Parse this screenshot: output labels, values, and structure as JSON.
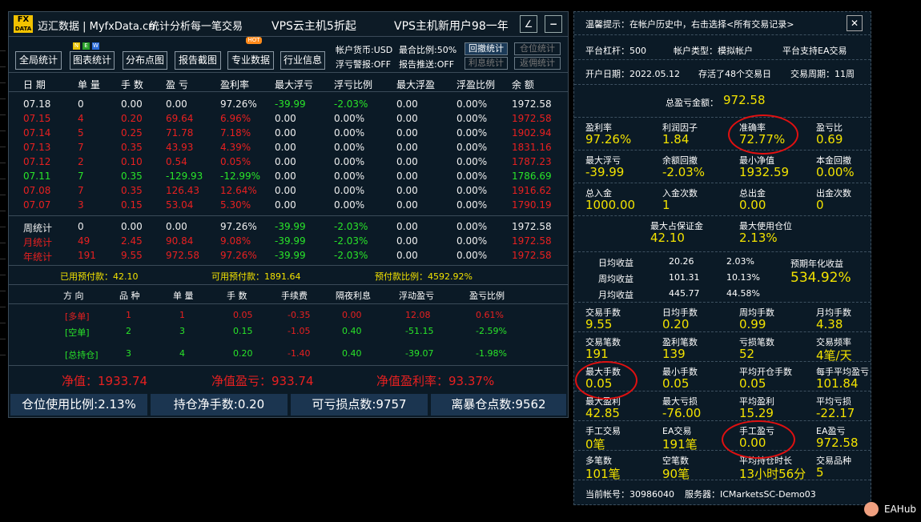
{
  "side_strip": [
    "",
    "",
    "",
    "",
    "",
    "",
    "",
    "",
    "",
    "",
    "",
    "",
    "",
    "",
    "",
    "",
    "",
    "",
    "",
    ""
  ],
  "titlebar": {
    "logo_top": "FX",
    "logo_bottom": "DATA",
    "site": "迈汇数据 | MyfxData.cn",
    "slogan": "统计分析每一笔交易",
    "ad1": "VPS云主机5折起",
    "ad2": "VPS主机新用户98一年",
    "edit_icon": "∠",
    "min_icon": "−"
  },
  "toolbar": {
    "buttons": [
      "全局统计",
      "图表统计",
      "分布点图",
      "报告截图",
      "专业数据",
      "行业信息"
    ],
    "new_badge": [
      "N",
      "E",
      "W"
    ],
    "hot_badge": "HOT",
    "info": {
      "currency": "帐户货币:USD",
      "max_ratio": "最合比例:50%",
      "float_alert": "浮亏警报:OFF",
      "report_push": "报告推送:OFF"
    },
    "side_buttons": [
      "回撤统计",
      "仓位统计",
      "利息统计",
      "返佣统计"
    ]
  },
  "table": {
    "headers": [
      "日 期",
      "单 量",
      "手 数",
      "盈 亏",
      "盈利率",
      "最大浮亏",
      "浮亏比例",
      "最大浮盈",
      "浮盈比例",
      "余 额"
    ],
    "rows": [
      {
        "date": "07.18",
        "orders": "0",
        "lots": "0.00",
        "pl": "0.00",
        "rate": "97.26%",
        "maxloss": "-39.99",
        "lossratio": "-2.03%",
        "maxprofit": "0.00",
        "profitratio": "0.00%",
        "balance": "1972.58",
        "color": "white"
      },
      {
        "date": "07.15",
        "orders": "4",
        "lots": "0.20",
        "pl": "69.64",
        "rate": "6.96%",
        "maxloss": "0.00",
        "lossratio": "0.00%",
        "maxprofit": "0.00",
        "profitratio": "0.00%",
        "balance": "1972.58",
        "color": "red"
      },
      {
        "date": "07.14",
        "orders": "5",
        "lots": "0.25",
        "pl": "71.78",
        "rate": "7.18%",
        "maxloss": "0.00",
        "lossratio": "0.00%",
        "maxprofit": "0.00",
        "profitratio": "0.00%",
        "balance": "1902.94",
        "color": "red"
      },
      {
        "date": "07.13",
        "orders": "7",
        "lots": "0.35",
        "pl": "43.93",
        "rate": "4.39%",
        "maxloss": "0.00",
        "lossratio": "0.00%",
        "maxprofit": "0.00",
        "profitratio": "0.00%",
        "balance": "1831.16",
        "color": "red"
      },
      {
        "date": "07.12",
        "orders": "2",
        "lots": "0.10",
        "pl": "0.54",
        "rate": "0.05%",
        "maxloss": "0.00",
        "lossratio": "0.00%",
        "maxprofit": "0.00",
        "profitratio": "0.00%",
        "balance": "1787.23",
        "color": "red"
      },
      {
        "date": "07.11",
        "orders": "7",
        "lots": "0.35",
        "pl": "-129.93",
        "rate": "-12.99%",
        "maxloss": "0.00",
        "lossratio": "0.00%",
        "maxprofit": "0.00",
        "profitratio": "0.00%",
        "balance": "1786.69",
        "color": "green"
      },
      {
        "date": "07.08",
        "orders": "7",
        "lots": "0.35",
        "pl": "126.43",
        "rate": "12.64%",
        "maxloss": "0.00",
        "lossratio": "0.00%",
        "maxprofit": "0.00",
        "profitratio": "0.00%",
        "balance": "1916.62",
        "color": "red"
      },
      {
        "date": "07.07",
        "orders": "3",
        "lots": "0.15",
        "pl": "53.04",
        "rate": "5.30%",
        "maxloss": "0.00",
        "lossratio": "0.00%",
        "maxprofit": "0.00",
        "profitratio": "0.00%",
        "balance": "1790.19",
        "color": "red"
      }
    ],
    "summary": [
      {
        "date": "周统计",
        "orders": "0",
        "lots": "0.00",
        "pl": "0.00",
        "rate": "97.26%",
        "maxloss": "-39.99",
        "lossratio": "-2.03%",
        "maxprofit": "0.00",
        "profitratio": "0.00%",
        "balance": "1972.58",
        "color": "white"
      },
      {
        "date": "月统计",
        "orders": "49",
        "lots": "2.45",
        "pl": "90.84",
        "rate": "9.08%",
        "maxloss": "-39.99",
        "lossratio": "-2.03%",
        "maxprofit": "0.00",
        "profitratio": "0.00%",
        "balance": "1972.58",
        "color": "red"
      },
      {
        "date": "年统计",
        "orders": "191",
        "lots": "9.55",
        "pl": "972.58",
        "rate": "97.26%",
        "maxloss": "-39.99",
        "lossratio": "-2.03%",
        "maxprofit": "0.00",
        "profitratio": "0.00%",
        "balance": "1972.58",
        "color": "red"
      }
    ]
  },
  "prepay": {
    "used": "已用预付款：42.10",
    "available": "可用预付款：1891.64",
    "ratio": "预付款比例：4592.92%"
  },
  "positions": {
    "headers": [
      "方 向",
      "品 种",
      "单 量",
      "手 数",
      "手续费",
      "隔夜利息",
      "浮动盈亏",
      "盈亏比例"
    ],
    "rows": [
      {
        "dir": "[多单]",
        "sym": "1",
        "orders": "1",
        "lots": "0.05",
        "fee": "-0.35",
        "swap": "0.00",
        "float": "12.08",
        "ratio": "0.61%",
        "color": "red"
      },
      {
        "dir": "[空单]",
        "sym": "2",
        "orders": "3",
        "lots": "0.15",
        "fee": "-1.05",
        "swap": "0.40",
        "float": "-51.15",
        "ratio": "-2.59%",
        "color": "green"
      },
      {
        "dir": "[总持仓]",
        "sym": "3",
        "orders": "4",
        "lots": "0.20",
        "fee": "-1.40",
        "swap": "0.40",
        "float": "-39.07",
        "ratio": "-1.98%",
        "color": "green"
      }
    ]
  },
  "equity": {
    "net": "净值：1933.74",
    "net_pl": "净值盈亏：933.74",
    "net_rate": "净值盈利率：93.37%"
  },
  "bottom": {
    "pos_ratio": "仓位使用比例:2.13%",
    "net_lots": "持仓净手数:0.20",
    "loss_points": "可亏损点数:9757",
    "liq_points": "离暴仓点数:9562"
  },
  "right": {
    "tip": "温馨提示：在帐户历史中，右击选择<所有交易记录>",
    "close_icon": "✕",
    "leverage": "平台杠杆：500",
    "acct_type": "帐户类型：模拟帐户",
    "ea_support": "平台支持EA交易",
    "open_date": "开户日期：2022.05.12",
    "trade_days": "存活了48个交易日",
    "trade_cycle": "交易周期：11周",
    "total_label": "总盈亏金额：",
    "total_value": "972.58",
    "g1": [
      {
        "label": "盈利率",
        "value": "97.26%"
      },
      {
        "label": "利润因子",
        "value": "1.84"
      },
      {
        "label": "准确率",
        "value": "72.77%"
      },
      {
        "label": "盈亏比",
        "value": "0.69"
      }
    ],
    "g2": [
      {
        "label": "最大浮亏",
        "value": "-39.99"
      },
      {
        "label": "余额回撤",
        "value": "-2.03%"
      },
      {
        "label": "最小净值",
        "value": "1932.59"
      },
      {
        "label": "本金回撤",
        "value": "0.00%"
      }
    ],
    "g3": [
      {
        "label": "总入金",
        "value": "1000.00"
      },
      {
        "label": "入金次数",
        "value": "1"
      },
      {
        "label": "总出金",
        "value": "0.00"
      },
      {
        "label": "出金次数",
        "value": "0"
      }
    ],
    "g4": [
      {
        "label": "最大占保证金",
        "value": "42.10"
      },
      {
        "label": "最大使用仓位",
        "value": "2.13%"
      }
    ],
    "daily": [
      {
        "label": "日均收益",
        "amount": "20.26",
        "pct": "2.03%"
      },
      {
        "label": "周均收益",
        "amount": "101.31",
        "pct": "10.13%"
      },
      {
        "label": "月均收益",
        "amount": "445.77",
        "pct": "44.58%"
      }
    ],
    "annual_label": "预期年化收益",
    "annual_value": "534.92%",
    "g5": [
      {
        "label": "交易手数",
        "value": "9.55"
      },
      {
        "label": "日均手数",
        "value": "0.20"
      },
      {
        "label": "周均手数",
        "value": "0.99"
      },
      {
        "label": "月均手数",
        "value": "4.38"
      }
    ],
    "g6": [
      {
        "label": "交易笔数",
        "value": "191"
      },
      {
        "label": "盈利笔数",
        "value": "139"
      },
      {
        "label": "亏损笔数",
        "value": "52"
      },
      {
        "label": "交易频率",
        "value": "4笔/天"
      }
    ],
    "g7": [
      {
        "label": "最大手数",
        "value": "0.05"
      },
      {
        "label": "最小手数",
        "value": "0.05"
      },
      {
        "label": "平均开仓手数",
        "value": "0.05"
      },
      {
        "label": "每手平均盈亏",
        "value": "101.84"
      }
    ],
    "g8": [
      {
        "label": "最大盈利",
        "value": "42.85"
      },
      {
        "label": "最大亏损",
        "value": "-76.00"
      },
      {
        "label": "平均盈利",
        "value": "15.29"
      },
      {
        "label": "平均亏损",
        "value": "-22.17"
      }
    ],
    "g9": [
      {
        "label": "手工交易",
        "value": "0笔"
      },
      {
        "label": "EA交易",
        "value": "191笔"
      },
      {
        "label": "手工盈亏",
        "value": "0.00"
      },
      {
        "label": "EA盈亏",
        "value": "972.58"
      }
    ],
    "g10": [
      {
        "label": "多笔数",
        "value": "101笔"
      },
      {
        "label": "空笔数",
        "value": "90笔"
      },
      {
        "label": "平均持仓时长",
        "value": "13小时56分"
      },
      {
        "label": "交易品种",
        "value": "5"
      }
    ],
    "account": "当前帐号：30986040",
    "server": "服务器：ICMarketsSC-Demo03"
  },
  "watermark": "EAHub",
  "colors": {
    "profit": "#e82020",
    "loss": "#29e429",
    "highlight": "#f2e200",
    "annotation": "#e01010"
  }
}
